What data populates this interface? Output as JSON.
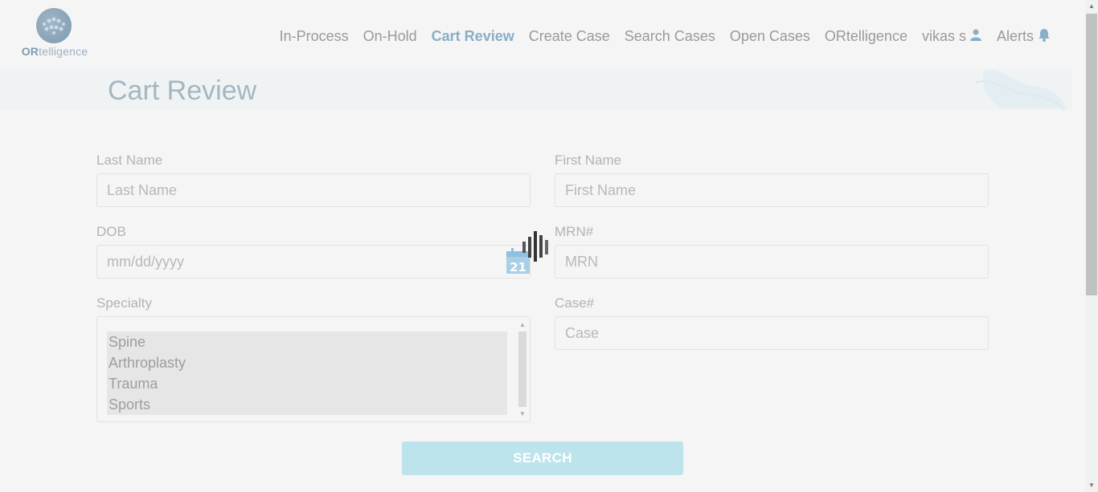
{
  "logo": {
    "text_bold": "OR",
    "text_rest": "telligence"
  },
  "nav": {
    "items": [
      {
        "label": "In-Process",
        "active": false
      },
      {
        "label": "On-Hold",
        "active": false
      },
      {
        "label": "Cart Review",
        "active": true
      },
      {
        "label": "Create Case",
        "active": false
      },
      {
        "label": "Search Cases",
        "active": false
      },
      {
        "label": "Open Cases",
        "active": false
      },
      {
        "label": "ORtelligence",
        "active": false
      }
    ],
    "user": {
      "label": "vikas s",
      "icon": "user-icon"
    },
    "alerts": {
      "label": "Alerts",
      "icon": "bell-icon"
    }
  },
  "page": {
    "title": "Cart Review"
  },
  "form": {
    "last_name": {
      "label": "Last Name",
      "placeholder": "Last Name",
      "value": ""
    },
    "first_name": {
      "label": "First Name",
      "placeholder": "First Name",
      "value": ""
    },
    "dob": {
      "label": "DOB",
      "placeholder": "mm/dd/yyyy",
      "value": "",
      "calendar_day": "21"
    },
    "mrn": {
      "label": "MRN#",
      "placeholder": "MRN",
      "value": ""
    },
    "specialty": {
      "label": "Specialty",
      "options": [
        "Spine",
        "Arthroplasty",
        "Trauma",
        "Sports"
      ]
    },
    "case": {
      "label": "Case#",
      "placeholder": "Case",
      "value": ""
    },
    "search_button": "SEARCH"
  },
  "colors": {
    "accent": "#8aaec6",
    "button": "#bde4ec",
    "title": "#a6b6c0"
  }
}
